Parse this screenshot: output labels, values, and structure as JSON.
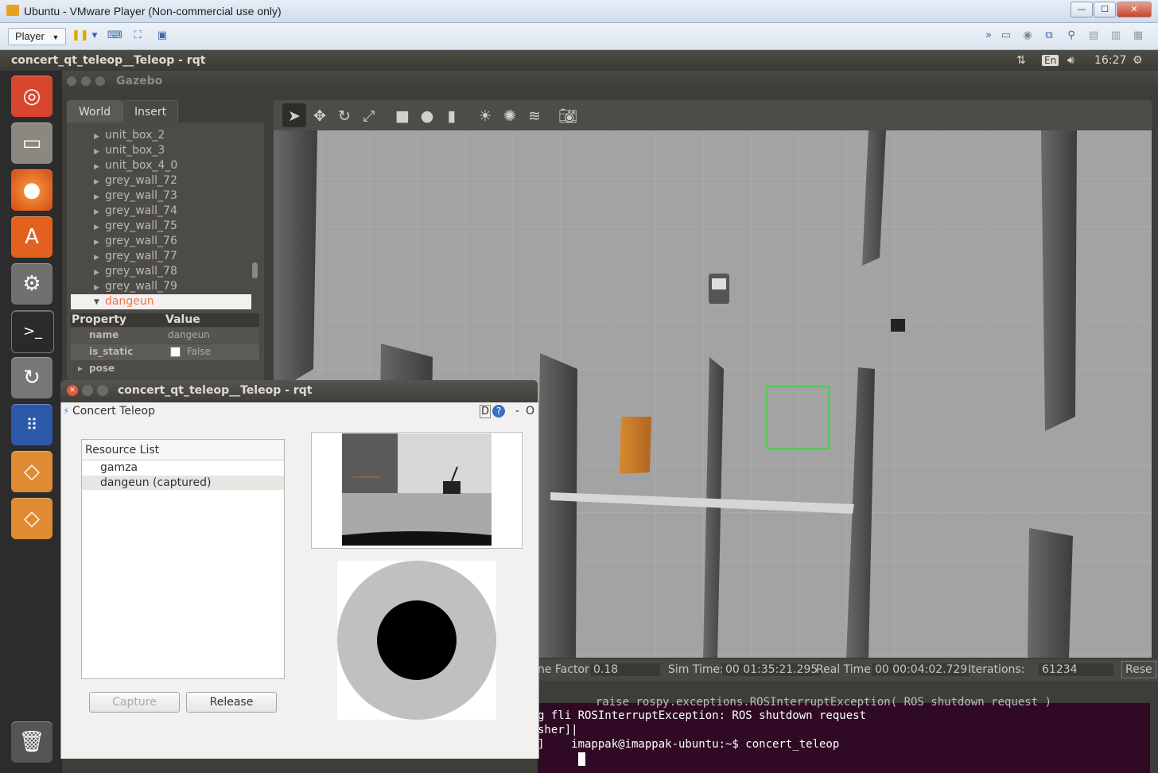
{
  "vmware": {
    "title": "Ubuntu - VMware Player (Non-commercial use only)",
    "player_label": "Player",
    "minimize": "—",
    "maximize": "☐",
    "close": "✕"
  },
  "ubuntu_panel": {
    "window_title": "concert_qt_teleop__Teleop - rqt",
    "keyboard_layout": "En",
    "time": "16:27"
  },
  "gazebo": {
    "title": "Gazebo",
    "tabs": [
      "World",
      "Insert"
    ],
    "tree_items": [
      "unit_box_2",
      "unit_box_3",
      "unit_box_4_0",
      "grey_wall_72",
      "grey_wall_73",
      "grey_wall_74",
      "grey_wall_75",
      "grey_wall_76",
      "grey_wall_77",
      "grey_wall_78",
      "grey_wall_79"
    ],
    "selected_item": "dangeun",
    "property_header": "Property",
    "value_header": "Value",
    "properties": [
      {
        "name": "name",
        "value": "dangeun"
      },
      {
        "name": "is_static",
        "value": "False"
      }
    ],
    "pose_label": "pose",
    "status": {
      "factor_label": "ne Factor:",
      "factor_value": "0.18",
      "sim_time_label": "Sim Time:",
      "sim_time_value": "00 01:35:21.295",
      "real_time_label": "Real Time:",
      "real_time_value": "00 00:04:02.729",
      "iterations_label": "Iterations:",
      "iterations_value": "61234",
      "reset_label": "Rese"
    }
  },
  "terminal": {
    "lines": [
      "  raise rospy.exceptions.ROSInterruptException( ROS shutdown request )",
      "g fli ROSInterruptException: ROS shutdown request",
      "sher]|",
      "]    imappak@imappak-ubuntu:~$ concert_teleop"
    ]
  },
  "rqt": {
    "title": "concert_qt_teleop__Teleop - rqt",
    "plugin_title": "Concert Teleop",
    "help_d": "D",
    "help_q": "?",
    "dash": "-",
    "o": "O",
    "resource_list_header": "Resource List",
    "resources": [
      "gamza",
      "dangeun (captured)"
    ],
    "capture_label": "Capture",
    "release_label": "Release"
  },
  "colors": {
    "selected_orange": "#f07746",
    "terminal_bg": "#300a24"
  }
}
